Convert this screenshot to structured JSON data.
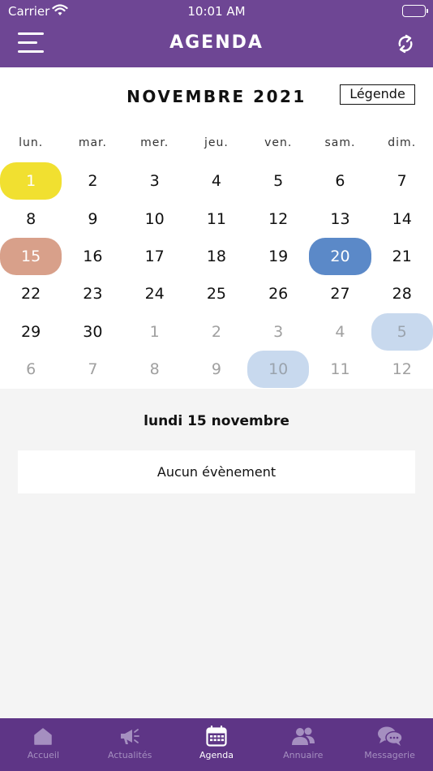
{
  "status_bar": {
    "carrier": "Carrier",
    "time": "10:01 AM"
  },
  "header": {
    "title": "AGENDA",
    "menu_icon": "hamburger-icon",
    "refresh_icon": "refresh-icon"
  },
  "calendar": {
    "month_title": "NOVEMBRE 2021",
    "legend_label": "Légende",
    "weekdays": [
      "lun.",
      "mar.",
      "mer.",
      "jeu.",
      "ven.",
      "sam.",
      "dim."
    ],
    "days": [
      {
        "label": "1",
        "current": true,
        "highlight": "yellow"
      },
      {
        "label": "2",
        "current": true
      },
      {
        "label": "3",
        "current": true
      },
      {
        "label": "4",
        "current": true
      },
      {
        "label": "5",
        "current": true
      },
      {
        "label": "6",
        "current": true
      },
      {
        "label": "7",
        "current": true
      },
      {
        "label": "8",
        "current": true
      },
      {
        "label": "9",
        "current": true
      },
      {
        "label": "10",
        "current": true
      },
      {
        "label": "11",
        "current": true
      },
      {
        "label": "12",
        "current": true
      },
      {
        "label": "13",
        "current": true
      },
      {
        "label": "14",
        "current": true
      },
      {
        "label": "15",
        "current": true,
        "highlight": "salmon"
      },
      {
        "label": "16",
        "current": true
      },
      {
        "label": "17",
        "current": true
      },
      {
        "label": "18",
        "current": true
      },
      {
        "label": "19",
        "current": true
      },
      {
        "label": "20",
        "current": true,
        "highlight": "blue"
      },
      {
        "label": "21",
        "current": true
      },
      {
        "label": "22",
        "current": true
      },
      {
        "label": "23",
        "current": true
      },
      {
        "label": "24",
        "current": true
      },
      {
        "label": "25",
        "current": true
      },
      {
        "label": "26",
        "current": true
      },
      {
        "label": "27",
        "current": true
      },
      {
        "label": "28",
        "current": true
      },
      {
        "label": "29",
        "current": true
      },
      {
        "label": "30",
        "current": true
      },
      {
        "label": "1",
        "current": false
      },
      {
        "label": "2",
        "current": false
      },
      {
        "label": "3",
        "current": false
      },
      {
        "label": "4",
        "current": false
      },
      {
        "label": "5",
        "current": false,
        "highlight": "lightblue"
      },
      {
        "label": "6",
        "current": false
      },
      {
        "label": "7",
        "current": false
      },
      {
        "label": "8",
        "current": false
      },
      {
        "label": "9",
        "current": false
      },
      {
        "label": "10",
        "current": false,
        "highlight": "lightblue"
      },
      {
        "label": "11",
        "current": false
      },
      {
        "label": "12",
        "current": false
      }
    ]
  },
  "selected_date": "lundi 15 novembre",
  "no_event_text": "Aucun évènement",
  "tabs": [
    {
      "label": "Accueil",
      "icon": "home-icon",
      "active": false
    },
    {
      "label": "Actualités",
      "icon": "megaphone-icon",
      "active": false
    },
    {
      "label": "Agenda",
      "icon": "calendar-icon",
      "active": true
    },
    {
      "label": "Annuaire",
      "icon": "people-icon",
      "active": false
    },
    {
      "label": "Messagerie",
      "icon": "chat-icon",
      "active": false
    }
  ],
  "colors": {
    "header": "#6e4694",
    "tabbar": "#5e3586",
    "highlight_yellow": "#f1e030",
    "highlight_salmon": "#d8a08a",
    "highlight_blue": "#5b89c8",
    "highlight_lightblue": "#c8d9ee"
  }
}
